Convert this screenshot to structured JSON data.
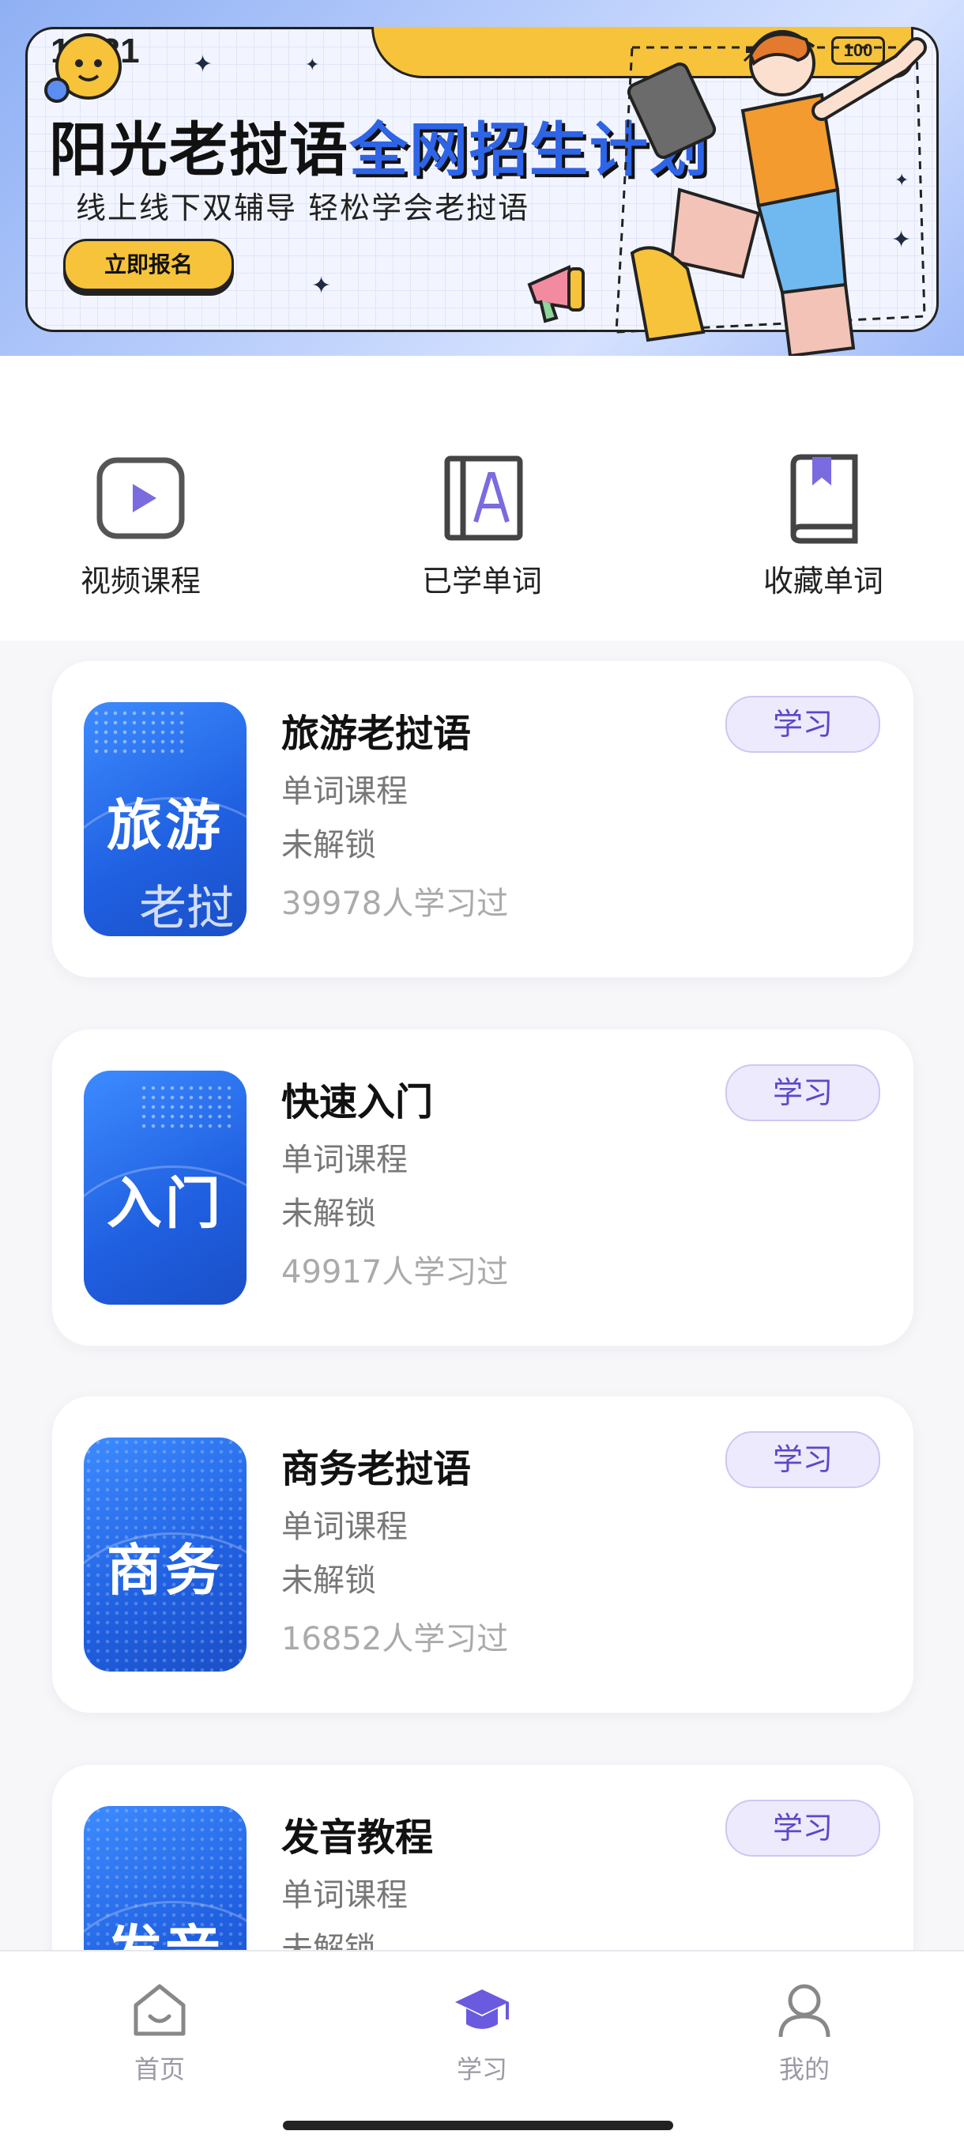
{
  "status_bar": {
    "time": "10:31",
    "battery": "100"
  },
  "banner": {
    "title_part1": "阳光老挝语",
    "title_part2": "全网招生计划",
    "subtitle": "线上线下双辅导 轻松学会老挝语",
    "cta_label": "立即报名"
  },
  "quick_actions": [
    {
      "label": "视频课程",
      "icon": "video-icon"
    },
    {
      "label": "已学单词",
      "icon": "learned-words-icon"
    },
    {
      "label": "收藏单词",
      "icon": "bookmark-book-icon"
    }
  ],
  "courses": [
    {
      "title": "旅游老挝语",
      "type": "单词课程",
      "status": "未解锁",
      "count": "39978人学习过",
      "thumb_text": "旅游",
      "thumb_sub": "老挝",
      "button": "学习"
    },
    {
      "title": "快速入门",
      "type": "单词课程",
      "status": "未解锁",
      "count": "49917人学习过",
      "thumb_text": "入门",
      "thumb_sub": "",
      "button": "学习"
    },
    {
      "title": "商务老挝语",
      "type": "单词课程",
      "status": "未解锁",
      "count": "16852人学习过",
      "thumb_text": "商务",
      "thumb_sub": "",
      "button": "学习"
    },
    {
      "title": "发音教程",
      "type": "单词课程",
      "status": "未解锁",
      "count": "",
      "thumb_text": "发音",
      "thumb_sub": "",
      "button": "学习"
    }
  ],
  "bottom_nav": [
    {
      "label": "首页",
      "icon": "home-icon"
    },
    {
      "label": "学习",
      "icon": "graduation-cap-icon",
      "active": true
    },
    {
      "label": "我的",
      "icon": "user-icon"
    }
  ],
  "colors": {
    "accent": "#5a49c8",
    "brand_blue": "#2e64e6",
    "banner_yellow": "#f6c33a"
  }
}
